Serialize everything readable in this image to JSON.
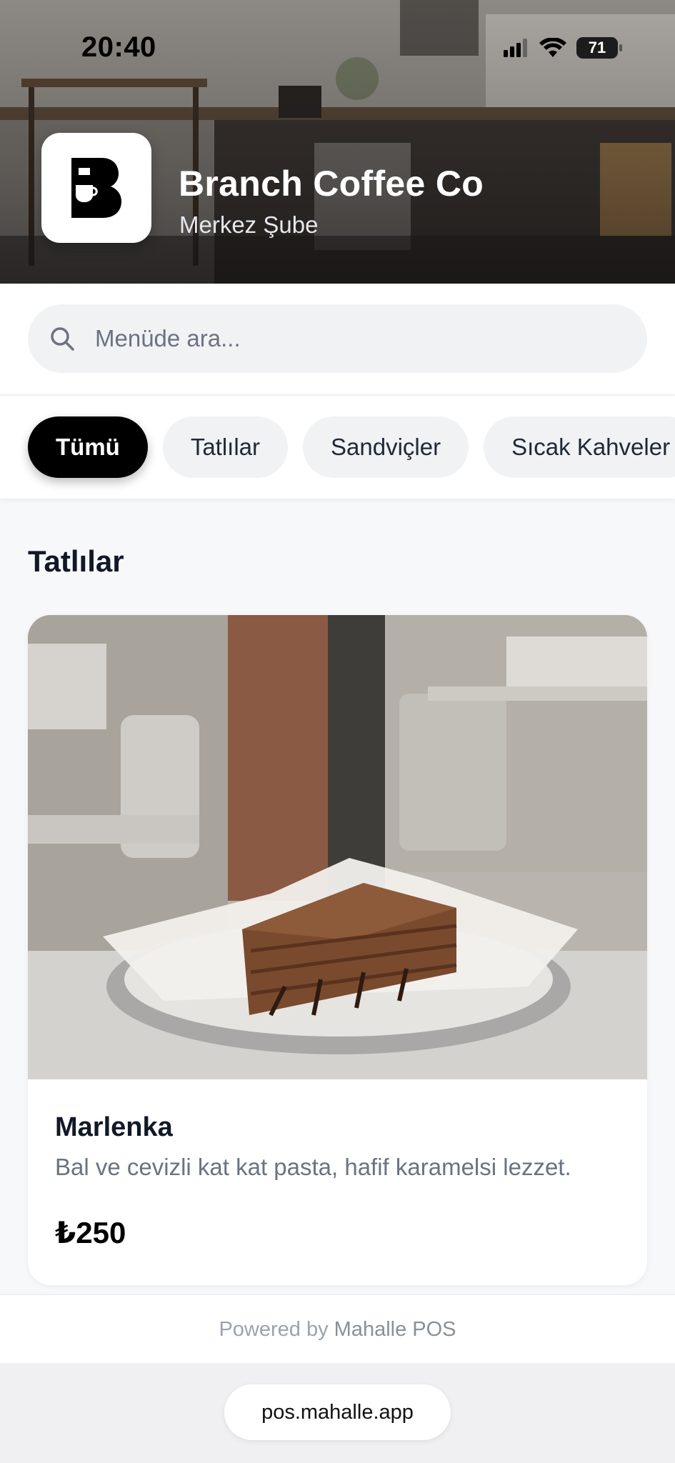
{
  "status_bar": {
    "time": "20:40",
    "battery": "71"
  },
  "header": {
    "brand_name": "Branch Coffee Co",
    "branch_name": "Merkez Şube",
    "logo_icon": "branch-coffee-logo"
  },
  "search": {
    "placeholder": "Menüde ara...",
    "value": ""
  },
  "categories": [
    {
      "label": "Tümü",
      "active": true
    },
    {
      "label": "Tatlılar",
      "active": false
    },
    {
      "label": "Sandviçler",
      "active": false
    },
    {
      "label": "Sıcak Kahveler",
      "active": false
    }
  ],
  "section": {
    "title": "Tatlılar",
    "items": [
      {
        "name": "Marlenka",
        "description": "Bal ve cevizli kat kat pasta, hafif karamelsi lezzet.",
        "price": "₺250"
      }
    ]
  },
  "footer": {
    "powered_prefix": "Powered by",
    "powered_brand": "Mahalle POS"
  },
  "browser": {
    "url": "pos.mahalle.app"
  },
  "colors": {
    "accent": "#000000",
    "chip_bg": "#f1f2f4",
    "muted_text": "#6b7280"
  }
}
